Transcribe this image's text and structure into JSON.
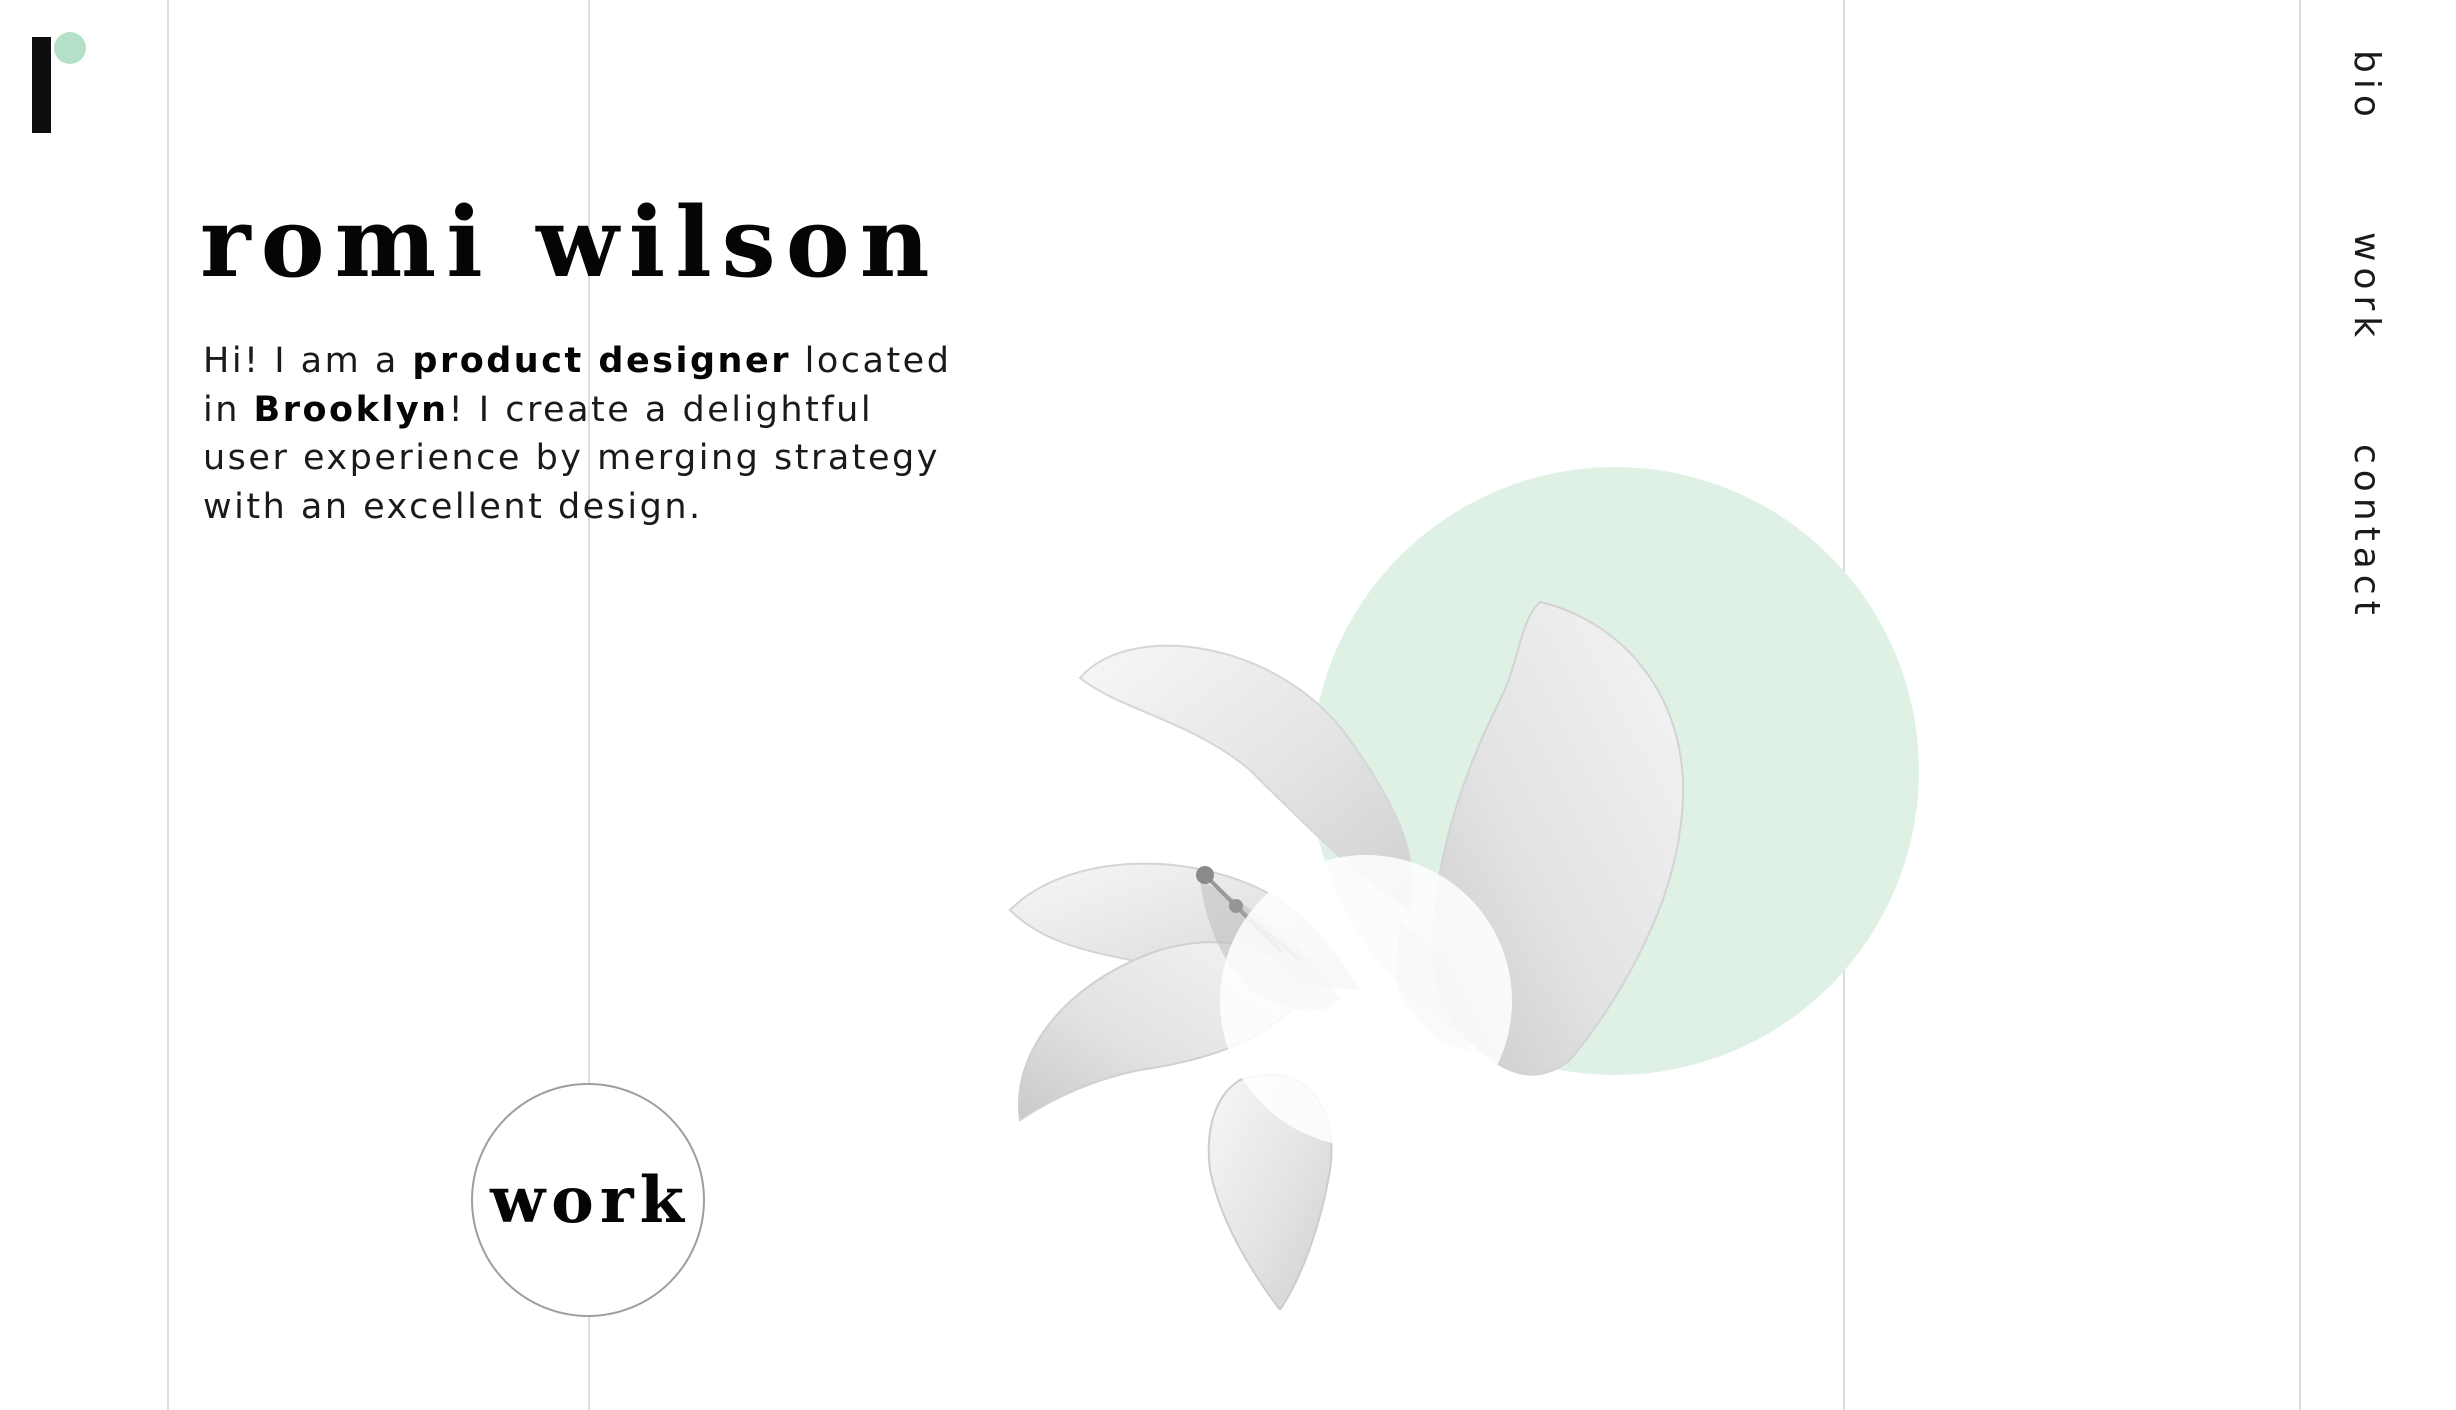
{
  "header": {
    "name": "romi wilson"
  },
  "intro": {
    "part1": "Hi! I am a ",
    "role": "product designer",
    "part2": " located in ",
    "city": "Brooklyn",
    "part3": "! I create a delightful user experience by merging strategy with an excellent design."
  },
  "work_button": {
    "label": "work"
  },
  "nav": {
    "items": [
      {
        "label": "bio"
      },
      {
        "label": "work"
      },
      {
        "label": "contact"
      }
    ]
  },
  "colors": {
    "accent_green": "#b5e0c8",
    "circle_green": "#dff0e5",
    "text": "#050505",
    "gridline": "#dcdcdc"
  },
  "icons": {
    "logo": "r-monogram-logo",
    "hero_image": "white-lily-flower"
  }
}
